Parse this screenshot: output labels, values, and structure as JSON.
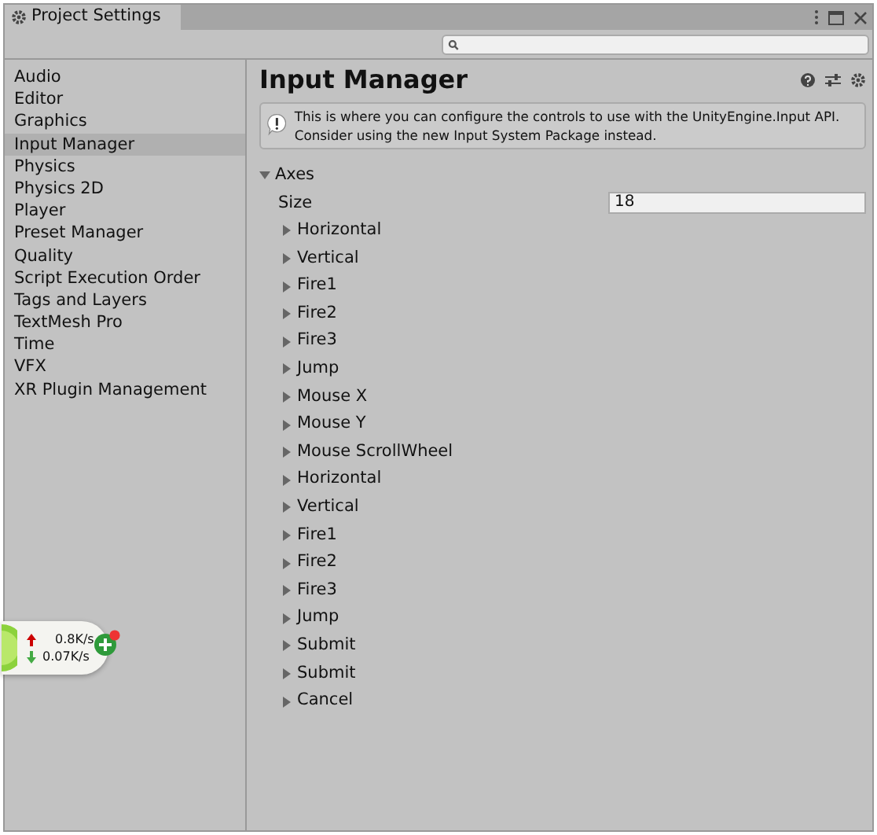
{
  "window": {
    "title": "Project Settings"
  },
  "sidebar": {
    "items": [
      {
        "label": "Audio",
        "selected": false
      },
      {
        "label": "Editor",
        "selected": false
      },
      {
        "label": "Graphics",
        "selected": false
      },
      {
        "label": "Input Manager",
        "selected": true
      },
      {
        "label": "Physics",
        "selected": false
      },
      {
        "label": "Physics 2D",
        "selected": false
      },
      {
        "label": "Player",
        "selected": false
      },
      {
        "label": "Preset Manager",
        "selected": false
      },
      {
        "label": "Quality",
        "selected": false
      },
      {
        "label": "Script Execution Order",
        "selected": false
      },
      {
        "label": "Tags and Layers",
        "selected": false
      },
      {
        "label": "TextMesh Pro",
        "selected": false
      },
      {
        "label": "Time",
        "selected": false
      },
      {
        "label": "VFX",
        "selected": false
      },
      {
        "label": "XR Plugin Management",
        "selected": false
      }
    ]
  },
  "panel": {
    "title": "Input Manager",
    "info": "This is where you can configure the controls to use with the UnityEngine.Input API. Consider using the new Input System Package instead.",
    "axes": {
      "label": "Axes",
      "expanded": true,
      "size_label": "Size",
      "size_value": "18",
      "items": [
        {
          "label": "Horizontal",
          "expanded": false
        },
        {
          "label": "Vertical",
          "expanded": false
        },
        {
          "label": "Fire1",
          "expanded": false
        },
        {
          "label": "Fire2",
          "expanded": false
        },
        {
          "label": "Fire3",
          "expanded": false
        },
        {
          "label": "Jump",
          "expanded": false
        },
        {
          "label": "Mouse X",
          "expanded": false
        },
        {
          "label": "Mouse Y",
          "expanded": false
        },
        {
          "label": "Mouse ScrollWheel",
          "expanded": false
        },
        {
          "label": "Horizontal",
          "expanded": false
        },
        {
          "label": "Vertical",
          "expanded": false
        },
        {
          "label": "Fire1",
          "expanded": false
        },
        {
          "label": "Fire2",
          "expanded": false
        },
        {
          "label": "Fire3",
          "expanded": false
        },
        {
          "label": "Jump",
          "expanded": false
        },
        {
          "label": "Submit",
          "expanded": false
        },
        {
          "label": "Submit",
          "expanded": false
        },
        {
          "label": "Cancel",
          "expanded": false
        }
      ]
    }
  },
  "net_widget": {
    "upload": "0.8K/s",
    "download": "0.07K/s"
  }
}
